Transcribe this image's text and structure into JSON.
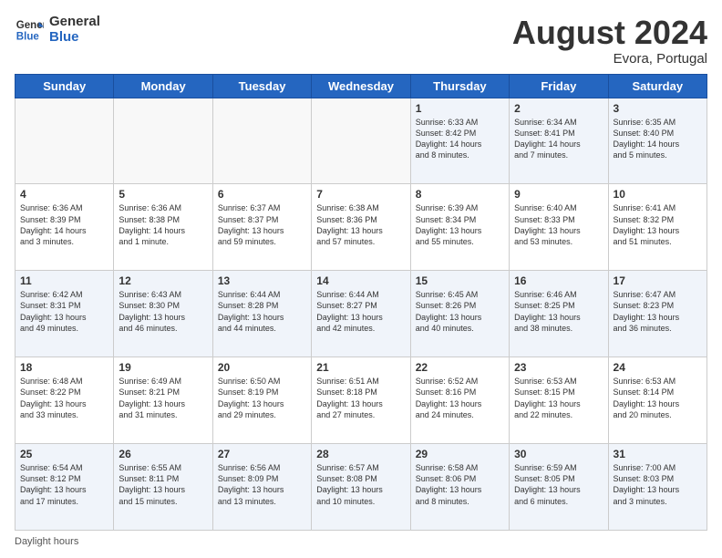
{
  "header": {
    "logo_line1": "General",
    "logo_line2": "Blue",
    "month_year": "August 2024",
    "location": "Evora, Portugal"
  },
  "days_of_week": [
    "Sunday",
    "Monday",
    "Tuesday",
    "Wednesday",
    "Thursday",
    "Friday",
    "Saturday"
  ],
  "footer": {
    "daylight_label": "Daylight hours"
  },
  "weeks": [
    [
      {
        "day": "",
        "info": ""
      },
      {
        "day": "",
        "info": ""
      },
      {
        "day": "",
        "info": ""
      },
      {
        "day": "",
        "info": ""
      },
      {
        "day": "1",
        "info": "Sunrise: 6:33 AM\nSunset: 8:42 PM\nDaylight: 14 hours\nand 8 minutes."
      },
      {
        "day": "2",
        "info": "Sunrise: 6:34 AM\nSunset: 8:41 PM\nDaylight: 14 hours\nand 7 minutes."
      },
      {
        "day": "3",
        "info": "Sunrise: 6:35 AM\nSunset: 8:40 PM\nDaylight: 14 hours\nand 5 minutes."
      }
    ],
    [
      {
        "day": "4",
        "info": "Sunrise: 6:36 AM\nSunset: 8:39 PM\nDaylight: 14 hours\nand 3 minutes."
      },
      {
        "day": "5",
        "info": "Sunrise: 6:36 AM\nSunset: 8:38 PM\nDaylight: 14 hours\nand 1 minute."
      },
      {
        "day": "6",
        "info": "Sunrise: 6:37 AM\nSunset: 8:37 PM\nDaylight: 13 hours\nand 59 minutes."
      },
      {
        "day": "7",
        "info": "Sunrise: 6:38 AM\nSunset: 8:36 PM\nDaylight: 13 hours\nand 57 minutes."
      },
      {
        "day": "8",
        "info": "Sunrise: 6:39 AM\nSunset: 8:34 PM\nDaylight: 13 hours\nand 55 minutes."
      },
      {
        "day": "9",
        "info": "Sunrise: 6:40 AM\nSunset: 8:33 PM\nDaylight: 13 hours\nand 53 minutes."
      },
      {
        "day": "10",
        "info": "Sunrise: 6:41 AM\nSunset: 8:32 PM\nDaylight: 13 hours\nand 51 minutes."
      }
    ],
    [
      {
        "day": "11",
        "info": "Sunrise: 6:42 AM\nSunset: 8:31 PM\nDaylight: 13 hours\nand 49 minutes."
      },
      {
        "day": "12",
        "info": "Sunrise: 6:43 AM\nSunset: 8:30 PM\nDaylight: 13 hours\nand 46 minutes."
      },
      {
        "day": "13",
        "info": "Sunrise: 6:44 AM\nSunset: 8:28 PM\nDaylight: 13 hours\nand 44 minutes."
      },
      {
        "day": "14",
        "info": "Sunrise: 6:44 AM\nSunset: 8:27 PM\nDaylight: 13 hours\nand 42 minutes."
      },
      {
        "day": "15",
        "info": "Sunrise: 6:45 AM\nSunset: 8:26 PM\nDaylight: 13 hours\nand 40 minutes."
      },
      {
        "day": "16",
        "info": "Sunrise: 6:46 AM\nSunset: 8:25 PM\nDaylight: 13 hours\nand 38 minutes."
      },
      {
        "day": "17",
        "info": "Sunrise: 6:47 AM\nSunset: 8:23 PM\nDaylight: 13 hours\nand 36 minutes."
      }
    ],
    [
      {
        "day": "18",
        "info": "Sunrise: 6:48 AM\nSunset: 8:22 PM\nDaylight: 13 hours\nand 33 minutes."
      },
      {
        "day": "19",
        "info": "Sunrise: 6:49 AM\nSunset: 8:21 PM\nDaylight: 13 hours\nand 31 minutes."
      },
      {
        "day": "20",
        "info": "Sunrise: 6:50 AM\nSunset: 8:19 PM\nDaylight: 13 hours\nand 29 minutes."
      },
      {
        "day": "21",
        "info": "Sunrise: 6:51 AM\nSunset: 8:18 PM\nDaylight: 13 hours\nand 27 minutes."
      },
      {
        "day": "22",
        "info": "Sunrise: 6:52 AM\nSunset: 8:16 PM\nDaylight: 13 hours\nand 24 minutes."
      },
      {
        "day": "23",
        "info": "Sunrise: 6:53 AM\nSunset: 8:15 PM\nDaylight: 13 hours\nand 22 minutes."
      },
      {
        "day": "24",
        "info": "Sunrise: 6:53 AM\nSunset: 8:14 PM\nDaylight: 13 hours\nand 20 minutes."
      }
    ],
    [
      {
        "day": "25",
        "info": "Sunrise: 6:54 AM\nSunset: 8:12 PM\nDaylight: 13 hours\nand 17 minutes."
      },
      {
        "day": "26",
        "info": "Sunrise: 6:55 AM\nSunset: 8:11 PM\nDaylight: 13 hours\nand 15 minutes."
      },
      {
        "day": "27",
        "info": "Sunrise: 6:56 AM\nSunset: 8:09 PM\nDaylight: 13 hours\nand 13 minutes."
      },
      {
        "day": "28",
        "info": "Sunrise: 6:57 AM\nSunset: 8:08 PM\nDaylight: 13 hours\nand 10 minutes."
      },
      {
        "day": "29",
        "info": "Sunrise: 6:58 AM\nSunset: 8:06 PM\nDaylight: 13 hours\nand 8 minutes."
      },
      {
        "day": "30",
        "info": "Sunrise: 6:59 AM\nSunset: 8:05 PM\nDaylight: 13 hours\nand 6 minutes."
      },
      {
        "day": "31",
        "info": "Sunrise: 7:00 AM\nSunset: 8:03 PM\nDaylight: 13 hours\nand 3 minutes."
      }
    ]
  ]
}
